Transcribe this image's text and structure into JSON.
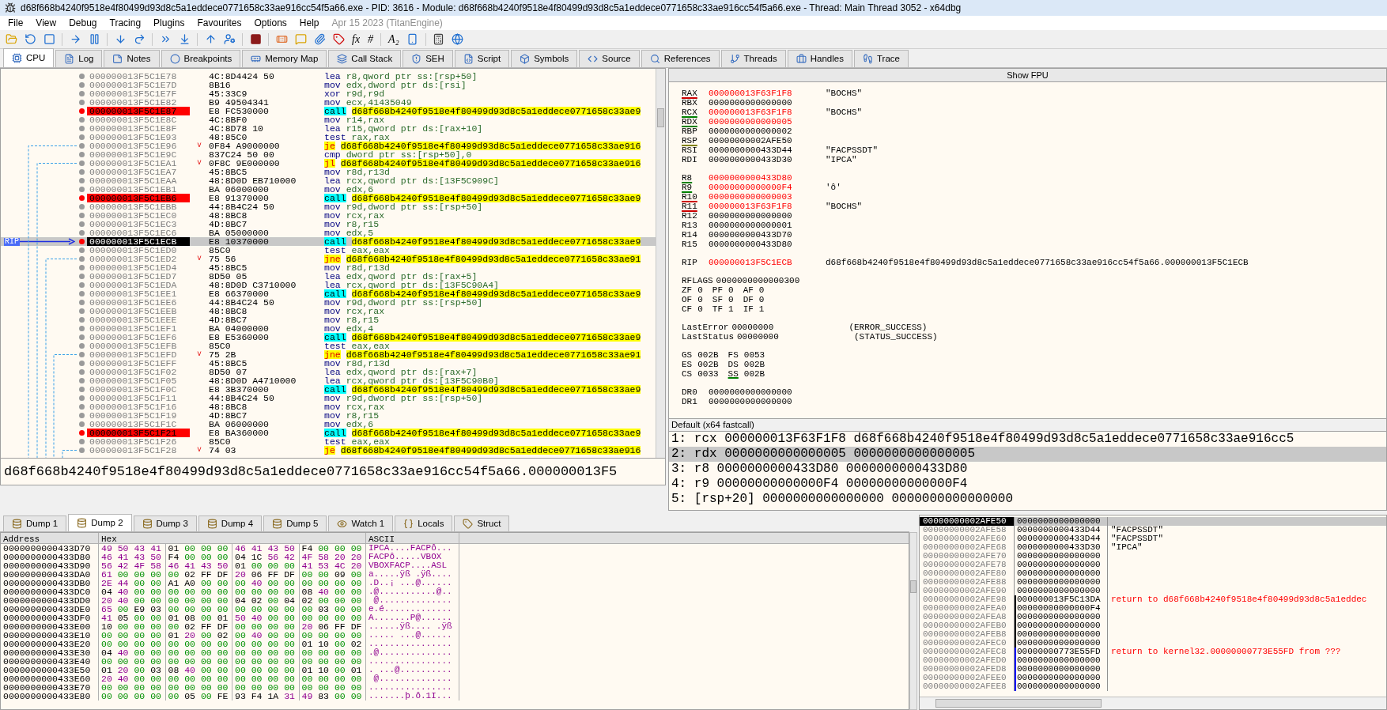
{
  "window": {
    "title": "d68f668b4240f9518e4f80499d93d8c5a1eddece0771658c33ae916cc54f5a66.exe - PID: 3616 - Module: d68f668b4240f9518e4f80499d93d8c5a1eddece0771658c33ae916cc54f5a66.exe - Thread: Main Thread 3052 - x64dbg"
  },
  "menu": {
    "items": [
      "File",
      "View",
      "Debug",
      "Tracing",
      "Plugins",
      "Favourites",
      "Options",
      "Help"
    ],
    "build_info": "Apr 15 2023 (TitanEngine)"
  },
  "toolbar": {
    "glyphs": [
      "fx",
      "#",
      "A₂"
    ]
  },
  "tabs": [
    {
      "label": "CPU",
      "selected": true
    },
    {
      "label": "Log",
      "selected": false
    },
    {
      "label": "Notes",
      "selected": false
    },
    {
      "label": "Breakpoints",
      "selected": false
    },
    {
      "label": "Memory Map",
      "selected": false
    },
    {
      "label": "Call Stack",
      "selected": false
    },
    {
      "label": "SEH",
      "selected": false
    },
    {
      "label": "Script",
      "selected": false
    },
    {
      "label": "Symbols",
      "selected": false
    },
    {
      "label": "Source",
      "selected": false
    },
    {
      "label": "References",
      "selected": false
    },
    {
      "label": "Threads",
      "selected": false
    },
    {
      "label": "Handles",
      "selected": false
    },
    {
      "label": "Trace",
      "selected": false
    }
  ],
  "disassembly": {
    "rip_label": "RIP",
    "rows": [
      {
        "address": "000000013F5C1E78",
        "bytes": "4C:8D4424 50",
        "mnemonic": "lea",
        "operands": "r8,qword ptr ss:[rsp+50]",
        "kind": "plain",
        "breakpoint": false,
        "current": false
      },
      {
        "address": "000000013F5C1E7D",
        "bytes": "8B16",
        "mnemonic": "mov",
        "operands": "edx,dword ptr ds:[rsi]",
        "kind": "plain",
        "breakpoint": false,
        "current": false
      },
      {
        "address": "000000013F5C1E7F",
        "bytes": "45:33C9",
        "mnemonic": "xor",
        "operands": "r9d,r9d",
        "kind": "plain",
        "breakpoint": false,
        "current": false
      },
      {
        "address": "000000013F5C1E82",
        "bytes": "B9 49504341",
        "mnemonic": "mov",
        "operands": "ecx,41435049",
        "kind": "plain",
        "breakpoint": false,
        "current": false
      },
      {
        "address": "000000013F5C1E87",
        "bytes": "E8 FC530000",
        "mnemonic": "call",
        "operands": "d68f668b4240f9518e4f80499d93d8c5a1eddece0771658c33ae9",
        "kind": "call",
        "breakpoint": true,
        "current": false
      },
      {
        "address": "000000013F5C1E8C",
        "bytes": "4C:8BF0",
        "mnemonic": "mov",
        "operands": "r14,rax",
        "kind": "plain",
        "breakpoint": false,
        "current": false
      },
      {
        "address": "000000013F5C1E8F",
        "bytes": "4C:8D78 10",
        "mnemonic": "lea",
        "operands": "r15,qword ptr ds:[rax+10]",
        "kind": "plain",
        "breakpoint": false,
        "current": false
      },
      {
        "address": "000000013F5C1E93",
        "bytes": "48:85C0",
        "mnemonic": "test",
        "operands": "rax,rax",
        "kind": "plain",
        "breakpoint": false,
        "current": false
      },
      {
        "address": "000000013F5C1E96",
        "mark": "˅",
        "bytes": "0F84 A9000000",
        "mnemonic": "je",
        "operands": "d68f668b4240f9518e4f80499d93d8c5a1eddece0771658c33ae916",
        "kind": "jump",
        "breakpoint": false,
        "current": false
      },
      {
        "address": "000000013F5C1E9C",
        "bytes": "837C24 50 00",
        "mnemonic": "cmp",
        "operands": "dword ptr ss:[rsp+50],0",
        "kind": "plain",
        "breakpoint": false,
        "current": false
      },
      {
        "address": "000000013F5C1EA1",
        "mark": "˅",
        "bytes": "0F8C 9E000000",
        "mnemonic": "jl",
        "operands": "d68f668b4240f9518e4f80499d93d8c5a1eddece0771658c33ae916",
        "kind": "jump",
        "breakpoint": false,
        "current": false
      },
      {
        "address": "000000013F5C1EA7",
        "bytes": "45:8BC5",
        "mnemonic": "mov",
        "operands": "r8d,r13d",
        "kind": "plain",
        "breakpoint": false,
        "current": false
      },
      {
        "address": "000000013F5C1EAA",
        "bytes": "48:8D0D EB710000",
        "mnemonic": "lea",
        "operands": "rcx,qword ptr ds:[13F5C909C]",
        "kind": "plain",
        "breakpoint": false,
        "current": false
      },
      {
        "address": "000000013F5C1EB1",
        "bytes": "BA 06000000",
        "mnemonic": "mov",
        "operands": "edx,6",
        "kind": "plain",
        "breakpoint": false,
        "current": false
      },
      {
        "address": "000000013F5C1EB6",
        "bytes": "E8 91370000",
        "mnemonic": "call",
        "operands": "d68f668b4240f9518e4f80499d93d8c5a1eddece0771658c33ae9",
        "kind": "call",
        "breakpoint": true,
        "current": false
      },
      {
        "address": "000000013F5C1EBB",
        "bytes": "44:8B4C24 50",
        "mnemonic": "mov",
        "operands": "r9d,dword ptr ss:[rsp+50]",
        "kind": "plain",
        "breakpoint": false,
        "current": false
      },
      {
        "address": "000000013F5C1EC0",
        "bytes": "48:8BC8",
        "mnemonic": "mov",
        "operands": "rcx,rax",
        "kind": "plain",
        "breakpoint": false,
        "current": false
      },
      {
        "address": "000000013F5C1EC3",
        "bytes": "4D:8BC7",
        "mnemonic": "mov",
        "operands": "r8,r15",
        "kind": "plain",
        "breakpoint": false,
        "current": false
      },
      {
        "address": "000000013F5C1EC6",
        "bytes": "BA 05000000",
        "mnemonic": "mov",
        "operands": "edx,5",
        "kind": "plain",
        "breakpoint": false,
        "current": false
      },
      {
        "address": "000000013F5C1ECB",
        "bytes": "E8 10370000",
        "mnemonic": "call",
        "operands": "d68f668b4240f9518e4f80499d93d8c5a1eddece0771658c33ae9",
        "kind": "call",
        "breakpoint": true,
        "current": true
      },
      {
        "address": "000000013F5C1ED0",
        "bytes": "85C0",
        "mnemonic": "test",
        "operands": "eax,eax",
        "kind": "plain",
        "breakpoint": false,
        "current": false
      },
      {
        "address": "000000013F5C1ED2",
        "mark": "˅",
        "bytes": "75 56",
        "mnemonic": "jne",
        "operands": "d68f668b4240f9518e4f80499d93d8c5a1eddece0771658c33ae91",
        "kind": "jump",
        "breakpoint": false,
        "current": false
      },
      {
        "address": "000000013F5C1ED4",
        "bytes": "45:8BC5",
        "mnemonic": "mov",
        "operands": "r8d,r13d",
        "kind": "plain",
        "breakpoint": false,
        "current": false
      },
      {
        "address": "000000013F5C1ED7",
        "bytes": "8D50 05",
        "mnemonic": "lea",
        "operands": "edx,qword ptr ds:[rax+5]",
        "kind": "plain",
        "breakpoint": false,
        "current": false
      },
      {
        "address": "000000013F5C1EDA",
        "bytes": "48:8D0D C3710000",
        "mnemonic": "lea",
        "operands": "rcx,qword ptr ds:[13F5C90A4]",
        "kind": "plain",
        "breakpoint": false,
        "current": false
      },
      {
        "address": "000000013F5C1EE1",
        "bytes": "E8 66370000",
        "mnemonic": "call",
        "operands": "d68f668b4240f9518e4f80499d93d8c5a1eddece0771658c33ae9",
        "kind": "call",
        "breakpoint": false,
        "current": false
      },
      {
        "address": "000000013F5C1EE6",
        "bytes": "44:8B4C24 50",
        "mnemonic": "mov",
        "operands": "r9d,dword ptr ss:[rsp+50]",
        "kind": "plain",
        "breakpoint": false,
        "current": false
      },
      {
        "address": "000000013F5C1EEB",
        "bytes": "48:8BC8",
        "mnemonic": "mov",
        "operands": "rcx,rax",
        "kind": "plain",
        "breakpoint": false,
        "current": false
      },
      {
        "address": "000000013F5C1EEE",
        "bytes": "4D:8BC7",
        "mnemonic": "mov",
        "operands": "r8,r15",
        "kind": "plain",
        "breakpoint": false,
        "current": false
      },
      {
        "address": "000000013F5C1EF1",
        "bytes": "BA 04000000",
        "mnemonic": "mov",
        "operands": "edx,4",
        "kind": "plain",
        "breakpoint": false,
        "current": false
      },
      {
        "address": "000000013F5C1EF6",
        "bytes": "E8 E5360000",
        "mnemonic": "call",
        "operands": "d68f668b4240f9518e4f80499d93d8c5a1eddece0771658c33ae9",
        "kind": "call",
        "breakpoint": false,
        "current": false
      },
      {
        "address": "000000013F5C1EFB",
        "bytes": "85C0",
        "mnemonic": "test",
        "operands": "eax,eax",
        "kind": "plain",
        "breakpoint": false,
        "current": false
      },
      {
        "address": "000000013F5C1EFD",
        "mark": "˅",
        "bytes": "75 2B",
        "mnemonic": "jne",
        "operands": "d68f668b4240f9518e4f80499d93d8c5a1eddece0771658c33ae91",
        "kind": "jump",
        "breakpoint": false,
        "current": false
      },
      {
        "address": "000000013F5C1EFF",
        "bytes": "45:8BC5",
        "mnemonic": "mov",
        "operands": "r8d,r13d",
        "kind": "plain",
        "breakpoint": false,
        "current": false
      },
      {
        "address": "000000013F5C1F02",
        "bytes": "8D50 07",
        "mnemonic": "lea",
        "operands": "edx,qword ptr ds:[rax+7]",
        "kind": "plain",
        "breakpoint": false,
        "current": false
      },
      {
        "address": "000000013F5C1F05",
        "bytes": "48:8D0D A4710000",
        "mnemonic": "lea",
        "operands": "rcx,qword ptr ds:[13F5C90B0]",
        "kind": "plain",
        "breakpoint": false,
        "current": false
      },
      {
        "address": "000000013F5C1F0C",
        "bytes": "E8 3B370000",
        "mnemonic": "call",
        "operands": "d68f668b4240f9518e4f80499d93d8c5a1eddece0771658c33ae9",
        "kind": "call",
        "breakpoint": false,
        "current": false
      },
      {
        "address": "000000013F5C1F11",
        "bytes": "44:8B4C24 50",
        "mnemonic": "mov",
        "operands": "r9d,dword ptr ss:[rsp+50]",
        "kind": "plain",
        "breakpoint": false,
        "current": false
      },
      {
        "address": "000000013F5C1F16",
        "bytes": "48:8BC8",
        "mnemonic": "mov",
        "operands": "rcx,rax",
        "kind": "plain",
        "breakpoint": false,
        "current": false
      },
      {
        "address": "000000013F5C1F19",
        "bytes": "4D:8BC7",
        "mnemonic": "mov",
        "operands": "r8,r15",
        "kind": "plain",
        "breakpoint": false,
        "current": false
      },
      {
        "address": "000000013F5C1F1C",
        "bytes": "BA 06000000",
        "mnemonic": "mov",
        "operands": "edx,6",
        "kind": "plain",
        "breakpoint": false,
        "current": false
      },
      {
        "address": "000000013F5C1F21",
        "bytes": "E8 BA360000",
        "mnemonic": "call",
        "operands": "d68f668b4240f9518e4f80499d93d8c5a1eddece0771658c33ae9",
        "kind": "call",
        "breakpoint": true,
        "current": false
      },
      {
        "address": "000000013F5C1F26",
        "bytes": "85C0",
        "mnemonic": "test",
        "operands": "eax,eax",
        "kind": "plain",
        "breakpoint": false,
        "current": false
      },
      {
        "address": "000000013F5C1F28",
        "mark": "˅",
        "bytes": "74 03",
        "mnemonic": "je",
        "operands": "d68f668b4240f9518e4f80499d93d8c5a1eddece0771658c33ae916",
        "kind": "jump",
        "breakpoint": false,
        "current": false
      }
    ],
    "info_line": "d68f668b4240f9518e4f80499d93d8c5a1eddece0771658c33ae916cc54f5a66.000000013F5"
  },
  "registers": {
    "fpu_button": "Show FPU",
    "groups": [
      [
        {
          "kind": "reg",
          "name": "RAX",
          "value": "000000013F63F1F8",
          "comment": "\"BOCHS\"",
          "modified": true,
          "color": "#cc0000"
        },
        {
          "kind": "reg",
          "name": "RBX",
          "value": "0000000000000000",
          "modified": false
        },
        {
          "kind": "reg",
          "name": "RCX",
          "value": "000000013F63F1F8",
          "comment": "\"BOCHS\"",
          "modified": true,
          "color": "#008000"
        },
        {
          "kind": "reg",
          "name": "RDX",
          "value": "0000000000000005",
          "modified": true,
          "color": "#008000"
        },
        {
          "kind": "reg",
          "name": "RBP",
          "value": "0000000000000002",
          "modified": false
        },
        {
          "kind": "reg",
          "name": "RSP",
          "value": "00000000002AFE50",
          "modified": false,
          "color": "#808000"
        },
        {
          "kind": "reg",
          "name": "RSI",
          "value": "0000000000433D44",
          "comment": "\"FACPSSDT\"",
          "modified": false
        },
        {
          "kind": "reg",
          "name": "RDI",
          "value": "0000000000433D30",
          "comment": "\"IPCA\"",
          "modified": false
        }
      ],
      [
        {
          "kind": "reg",
          "name": "R8",
          "value": "0000000000433D80",
          "modified": true,
          "color": "#008000"
        },
        {
          "kind": "reg",
          "name": "R9",
          "value": "00000000000000F4",
          "comment": "'ô'",
          "modified": true,
          "color": "#008000"
        },
        {
          "kind": "reg",
          "name": "R10",
          "value": "0000000000000003",
          "modified": true,
          "color": "#cc0000"
        },
        {
          "kind": "reg",
          "name": "R11",
          "value": "000000013F63F1F8",
          "comment": "\"BOCHS\"",
          "modified": true,
          "color": "#cc0000"
        },
        {
          "kind": "reg",
          "name": "R12",
          "value": "0000000000000000",
          "modified": false
        },
        {
          "kind": "reg",
          "name": "R13",
          "value": "0000000000000001",
          "modified": false
        },
        {
          "kind": "reg",
          "name": "R14",
          "value": "0000000000433D70",
          "modified": false
        },
        {
          "kind": "reg",
          "name": "R15",
          "value": "0000000000433D80",
          "modified": false
        }
      ],
      [
        {
          "kind": "reg",
          "name": "RIP",
          "value": "000000013F5C1ECB",
          "comment": "d68f668b4240f9518e4f80499d93d8c5a1eddece0771658c33ae916cc54f5a66.000000013F5C1ECB",
          "modified": true
        }
      ],
      [
        {
          "kind": "reg",
          "name": "RFLAGS",
          "value": "0000000000000300",
          "modified": false
        },
        {
          "kind": "pairs",
          "items": [
            {
              "name": "ZF",
              "value": "0"
            },
            {
              "name": "PF",
              "value": "0"
            },
            {
              "name": "AF",
              "value": "0"
            }
          ]
        },
        {
          "kind": "pairs",
          "items": [
            {
              "name": "OF",
              "value": "0"
            },
            {
              "name": "SF",
              "value": "0"
            },
            {
              "name": "DF",
              "value": "0"
            }
          ]
        },
        {
          "kind": "pairs",
          "items": [
            {
              "name": "CF",
              "value": "0"
            },
            {
              "name": "TF",
              "value": "1"
            },
            {
              "name": "IF",
              "value": "1"
            }
          ]
        }
      ],
      [
        {
          "kind": "reg",
          "name": "LastError",
          "value": "00000000",
          "comment": "(ERROR_SUCCESS)",
          "modified": false
        },
        {
          "kind": "reg",
          "name": "LastStatus",
          "value": "00000000",
          "comment": "(STATUS_SUCCESS)",
          "modified": false
        }
      ],
      [
        {
          "kind": "pairs",
          "items": [
            {
              "name": "GS",
              "value": "002B"
            },
            {
              "name": "FS",
              "value": "0053"
            }
          ]
        },
        {
          "kind": "pairs",
          "items": [
            {
              "name": "ES",
              "value": "002B"
            },
            {
              "name": "DS",
              "value": "002B"
            }
          ]
        },
        {
          "kind": "pairs",
          "items": [
            {
              "name": "CS",
              "value": "0033"
            },
            {
              "name": "SS",
              "value": "002B",
              "color": "#008000"
            }
          ]
        }
      ],
      [
        {
          "kind": "reg",
          "name": "DR0",
          "value": "0000000000000000",
          "modified": false
        },
        {
          "kind": "reg",
          "name": "DR1",
          "value": "0000000000000000",
          "modified": false
        }
      ]
    ]
  },
  "arguments": {
    "title": "Default (x64 fastcall)",
    "rows": [
      {
        "text": "1: rcx 000000013F63F1F8 d68f668b4240f9518e4f80499d93d8c5a1eddece0771658c33ae916cc5",
        "selected": false
      },
      {
        "text": "2: rdx 0000000000000005 0000000000000005",
        "selected": true
      },
      {
        "text": "3: r8 0000000000433D80 0000000000433D80",
        "selected": false
      },
      {
        "text": "4: r9 00000000000000F4 00000000000000F4",
        "selected": false
      },
      {
        "text": "5: [rsp+20] 0000000000000000 0000000000000000",
        "selected": false
      }
    ]
  },
  "dump": {
    "tabs": [
      {
        "label": "Dump 1",
        "selected": false
      },
      {
        "label": "Dump 2",
        "selected": true
      },
      {
        "label": "Dump 3",
        "selected": false
      },
      {
        "label": "Dump 4",
        "selected": false
      },
      {
        "label": "Dump 5",
        "selected": false
      },
      {
        "label": "Watch 1",
        "selected": false
      },
      {
        "label": "Locals",
        "selected": false
      },
      {
        "label": "Struct",
        "selected": false
      }
    ],
    "columns": [
      "Address",
      "Hex",
      "ASCII"
    ],
    "rows": [
      {
        "address": "0000000000433D70",
        "hex": "49 50 43 41 01 00 00 00 46 41 43 50 F4 00 00 00",
        "ascii": "IPCA....FACPô..."
      },
      {
        "address": "0000000000433D80",
        "hex": "46 41 43 50 F4 00 00 00 04 1C 56 42 4F 58 20 20",
        "ascii": "FACPô.....VBOX"
      },
      {
        "address": "0000000000433D90",
        "hex": "56 42 4F 58 46 41 43 50 01 00 00 00 41 53 4C 20",
        "ascii": "VBOXFACP....ASL"
      },
      {
        "address": "0000000000433DA0",
        "hex": "61 00 00 00 00 02 FF DF 20 06 FF DF 00 00 09 00",
        "ascii": "a.....ÿß .ÿß...."
      },
      {
        "address": "0000000000433DB0",
        "hex": "2E 44 00 00 A1 A0 00 00 00 40 00 00 00 00 00 00",
        "ascii": ".D..¡ ...@......"
      },
      {
        "address": "0000000000433DC0",
        "hex": "04 40 00 00 00 00 00 00 00 00 00 00 08 40 00 00",
        "ascii": ".@...........@.."
      },
      {
        "address": "0000000000433DD0",
        "hex": "20 40 00 00 00 00 00 00 04 02 00 04 02 00 00 00",
        "ascii": " @.............."
      },
      {
        "address": "0000000000433DE0",
        "hex": "65 00 E9 03 00 00 00 00 00 00 00 00 00 03 00 00",
        "ascii": "e.é............."
      },
      {
        "address": "0000000000433DF0",
        "hex": "41 05 00 00 01 08 00 01 50 40 00 00 00 00 00 00",
        "ascii": "A.......P@......"
      },
      {
        "address": "0000000000433E00",
        "hex": "10 00 00 00 00 02 FF DF 00 00 00 00 20 06 FF DF",
        "ascii": "......ÿß.... .ÿß"
      },
      {
        "address": "0000000000433E10",
        "hex": "00 00 00 00 01 20 00 02 00 40 00 00 00 00 00 00",
        "ascii": "..... ...@......"
      },
      {
        "address": "0000000000433E20",
        "hex": "00 00 00 00 00 00 00 00 00 00 00 00 01 10 00 02",
        "ascii": "................"
      },
      {
        "address": "0000000000433E30",
        "hex": "04 40 00 00 00 00 00 00 00 00 00 00 00 00 00 00",
        "ascii": ".@.............."
      },
      {
        "address": "0000000000433E40",
        "hex": "00 00 00 00 00 00 00 00 00 00 00 00 00 00 00 00",
        "ascii": "................"
      },
      {
        "address": "0000000000433E50",
        "hex": "01 20 00 03 08 40 00 00 00 00 00 00 01 10 00 01",
        "ascii": ". ...@.........."
      },
      {
        "address": "0000000000433E60",
        "hex": "20 40 00 00 00 00 00 00 00 00 00 00 00 00 00 00",
        "ascii": " @.............."
      },
      {
        "address": "0000000000433E70",
        "hex": "00 00 00 00 00 00 00 00 00 00 00 00 00 00 00 00",
        "ascii": "................"
      },
      {
        "address": "0000000000433E80",
        "hex": "00 00 00 00 00 05 00 FE 93 F4 1A 31 49 83 00 00",
        "ascii": ".......þ.ô.1I..."
      }
    ]
  },
  "stack": {
    "rows": [
      {
        "address": "00000000002AFE50",
        "value": "0000000000000000",
        "selected": true
      },
      {
        "address": "00000000002AFE58",
        "value": "0000000000433D44",
        "comment": "\"FACPSSDT\"",
        "kind": "string",
        "selected": false
      },
      {
        "address": "00000000002AFE60",
        "value": "0000000000433D44",
        "comment": "\"FACPSSDT\"",
        "kind": "string",
        "selected": false
      },
      {
        "address": "00000000002AFE68",
        "value": "0000000000433D30",
        "comment": "\"IPCA\"",
        "kind": "string",
        "selected": false
      },
      {
        "address": "00000000002AFE70",
        "value": "0000000000000000",
        "selected": false
      },
      {
        "address": "00000000002AFE78",
        "value": "0000000000000000",
        "selected": false
      },
      {
        "address": "00000000002AFE80",
        "value": "0000000000000000",
        "selected": false
      },
      {
        "address": "00000000002AFE88",
        "value": "0000000000000000",
        "selected": false
      },
      {
        "address": "00000000002AFE90",
        "value": "0000000000000000",
        "selected": false
      },
      {
        "address": "00000000002AFE98",
        "value": "000000013F5C13DA",
        "comment": "return to d68f668b4240f9518e4f80499d93d8c5a1eddec",
        "kind": "return",
        "color": "#000000",
        "selected": false
      },
      {
        "address": "00000000002AFEA0",
        "value": "00000000000000F4",
        "color": "#000000",
        "selected": false
      },
      {
        "address": "00000000002AFEA8",
        "value": "0000000000000000",
        "color": "#000000",
        "selected": false
      },
      {
        "address": "00000000002AFEB0",
        "value": "0000000000000000",
        "color": "#000000",
        "selected": false
      },
      {
        "address": "00000000002AFEB8",
        "value": "0000000000000000",
        "color": "#000000",
        "selected": false
      },
      {
        "address": "00000000002AFEC0",
        "value": "0000000000000000",
        "color": "#000000",
        "selected": false
      },
      {
        "address": "00000000002AFEC8",
        "value": "00000000773E55FD",
        "comment": "return to kernel32.00000000773E55FD from ???",
        "kind": "return",
        "color": "#0000ff",
        "selected": false
      },
      {
        "address": "00000000002AFED0",
        "value": "0000000000000000",
        "color": "#0000ff",
        "selected": false
      },
      {
        "address": "00000000002AFED8",
        "value": "0000000000000000",
        "color": "#0000ff",
        "selected": false
      },
      {
        "address": "00000000002AFEE0",
        "value": "0000000000000000",
        "color": "#0000ff",
        "selected": false
      },
      {
        "address": "00000000002AFEE8",
        "value": "0000000000000000",
        "color": "#0000ff",
        "selected": false
      }
    ]
  }
}
